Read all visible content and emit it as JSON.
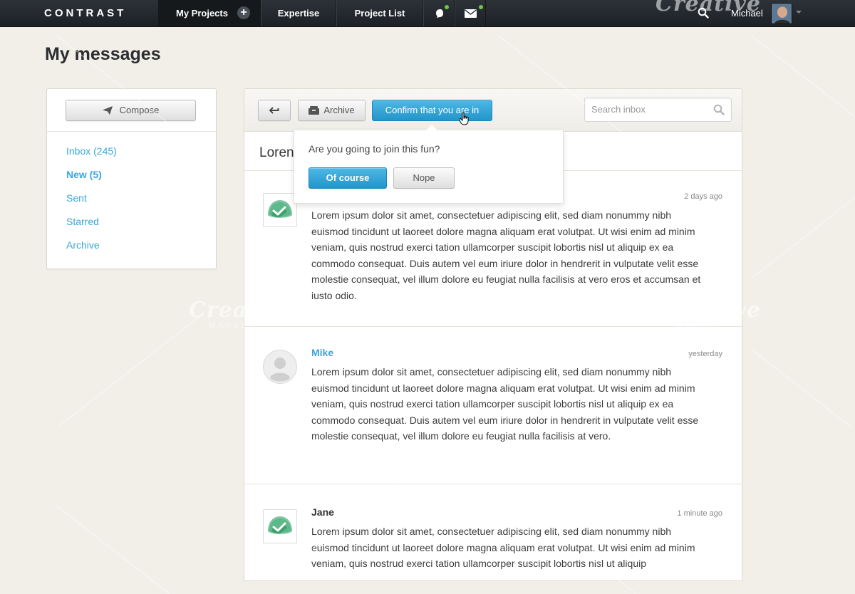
{
  "nav": {
    "brand": "CONTRAST",
    "items": [
      {
        "label": "My Projects"
      },
      {
        "label": "Expertise"
      },
      {
        "label": "Project List"
      }
    ],
    "plus": "+",
    "user_name": "Michael"
  },
  "page": {
    "title": "My messages"
  },
  "sidebar": {
    "compose_label": "Compose",
    "links": [
      {
        "label": "Inbox (245)"
      },
      {
        "label": "New (5)"
      },
      {
        "label": "Sent"
      },
      {
        "label": "Starred"
      },
      {
        "label": "Archive"
      }
    ]
  },
  "toolbar": {
    "archive_label": "Archive",
    "confirm_label": "Confirm that you are in",
    "search_placeholder": "Search inbox"
  },
  "thread": {
    "title": "Loren"
  },
  "popover": {
    "question": "Are you going to join this fun?",
    "yes_label": "Of course",
    "no_label": "Nope"
  },
  "messages": [
    {
      "name": "",
      "time": "2 days ago",
      "body": "Lorem ipsum dolor sit amet, consectetuer adipiscing elit, sed diam nonummy nibh euismod tincidunt ut laoreet dolore magna aliquam erat volutpat. Ut wisi enim ad minim veniam, quis nostrud exerci tation ullamcorper suscipit lobortis nisl ut aliquip ex ea commodo consequat. Duis autem vel eum iriure dolor in hendrerit in vulputate velit esse molestie consequat, vel illum dolore eu feugiat nulla facilisis at vero eros et accumsan et iusto odio."
    },
    {
      "name": "Mike",
      "time": "yesterday",
      "body": "Lorem ipsum dolor sit amet, consectetuer adipiscing elit, sed diam nonummy nibh euismod tincidunt ut laoreet dolore magna aliquam erat volutpat. Ut wisi enim ad minim veniam, quis nostrud exerci tation ullamcorper suscipit lobortis nisl ut aliquip ex ea commodo consequat. Duis autem vel eum iriure dolor in hendrerit in vulputate velit esse molestie consequat, vel illum dolore eu feugiat nulla facilisis at vero."
    },
    {
      "name": "Jane",
      "time": "1 minute ago",
      "body": "Lorem ipsum dolor sit amet, consectetuer adipiscing elit, sed diam nonummy nibh euismod tincidunt ut laoreet dolore magna aliquam erat volutpat. Ut wisi enim ad minim veniam, quis nostrud exerci tation ullamcorper suscipit lobortis nisl ut aliquip"
    }
  ],
  "watermark": {
    "text": "Creative",
    "sub": "MARKET"
  },
  "colors": {
    "accent": "#3aa7d8",
    "nav_bg": "#23272c",
    "online": "#6fc83e",
    "primary_button": "#2a9bd0"
  },
  "icons": [
    "plus-icon",
    "notification-icon",
    "mail-icon",
    "search-icon",
    "send-icon",
    "reply-icon",
    "archive-icon",
    "cursor-hand-icon",
    "basecamp-icon",
    "user-silhouette-icon"
  ]
}
